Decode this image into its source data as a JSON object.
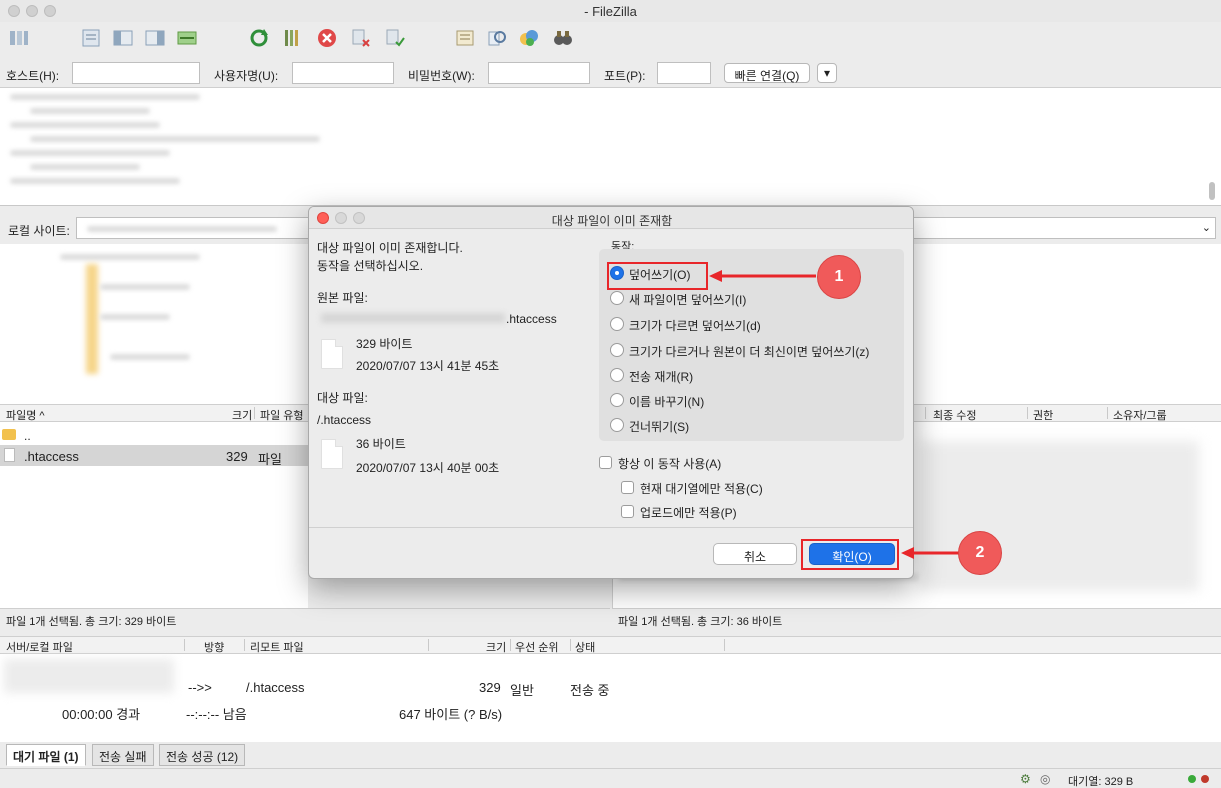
{
  "window": {
    "title": "- FileZilla"
  },
  "toolbar": {
    "icons": [
      "site-manager-icon",
      "toggle-log-icon",
      "toggle-local-tree-icon",
      "toggle-remote-tree-icon",
      "toggle-queue-icon",
      "refresh-icon",
      "process-queue-icon",
      "cancel-icon",
      "disconnect-icon",
      "reconnect-icon",
      "filter-icon",
      "compare-icon",
      "sync-browse-icon",
      "find-icon"
    ]
  },
  "quickconnect": {
    "host_label": "호스트(H):",
    "user_label": "사용자명(U):",
    "pass_label": "비밀번호(W):",
    "port_label": "포트(P):",
    "connect_label": "빠른 연결(Q)",
    "dropdown_glyph": "▾"
  },
  "local": {
    "site_label": "로컬 사이트:",
    "columns": {
      "name": "파일명 ^",
      "size": "크기",
      "type": "파일 유형"
    },
    "files": [
      {
        "name": "..",
        "size": "",
        "type": ""
      },
      {
        "name": ".htaccess",
        "size": "329",
        "type": "파일"
      }
    ],
    "status": "파일 1개 선택됨. 총 크기: 329 바이트"
  },
  "remote": {
    "columns": {
      "modified": "최종 수정",
      "perm": "권한",
      "owner": "소유자/그룹"
    },
    "status": "파일 1개 선택됨. 총 크기: 36 바이트"
  },
  "queue": {
    "columns": {
      "local": "서버/로컬 파일",
      "dir": "방향",
      "remote": "리모트 파일",
      "size": "크기",
      "priority": "우선 순위",
      "status": "상태"
    },
    "row": {
      "dir": "-->>",
      "remote": "/.htaccess",
      "size": "329",
      "priority": "일반",
      "status": "전송 중"
    },
    "progress": {
      "elapsed": "00:00:00 경과",
      "left": "--:--:-- 남음",
      "bytes": "647 바이트 (? B/s)"
    }
  },
  "tabs": [
    {
      "label": "대기 파일 (1)",
      "active": true
    },
    {
      "label": "전송 실패",
      "active": false
    },
    {
      "label": "전송 성공 (12)",
      "active": false
    }
  ],
  "statusbar": {
    "queue": "대기열: 329 B"
  },
  "dialog": {
    "title": "대상 파일이 이미 존재함",
    "message1": "대상 파일이 이미 존재합니다.",
    "message2": "동작을 선택하십시오.",
    "source_label": "원본 파일:",
    "source_name": ".htaccess",
    "source_size": "329 바이트",
    "source_date": "2020/07/07 13시 41분 45초",
    "target_label": "대상 파일:",
    "target_name": "/.htaccess",
    "target_size": "36 바이트",
    "target_date": "2020/07/07 13시 40분 00초",
    "action_label": "동작:",
    "options": [
      {
        "label": "덮어쓰기(O)",
        "selected": true
      },
      {
        "label": "새 파일이면 덮어쓰기(I)",
        "selected": false
      },
      {
        "label": "크기가 다르면 덮어쓰기(d)",
        "selected": false
      },
      {
        "label": "크기가 다르거나 원본이 더 최신이면 덮어쓰기(z)",
        "selected": false
      },
      {
        "label": "전송 재개(R)",
        "selected": false
      },
      {
        "label": "이름 바꾸기(N)",
        "selected": false
      },
      {
        "label": "건너뛰기(S)",
        "selected": false
      }
    ],
    "always_label": "항상 이 동작 사용(A)",
    "queue_only_label": "현재 대기열에만 적용(C)",
    "upload_only_label": "업로드에만 적용(P)",
    "cancel_label": "취소",
    "ok_label": "확인(O)"
  },
  "annotations": {
    "badge1": "1",
    "badge2": "2",
    "color": "#e8262a"
  }
}
